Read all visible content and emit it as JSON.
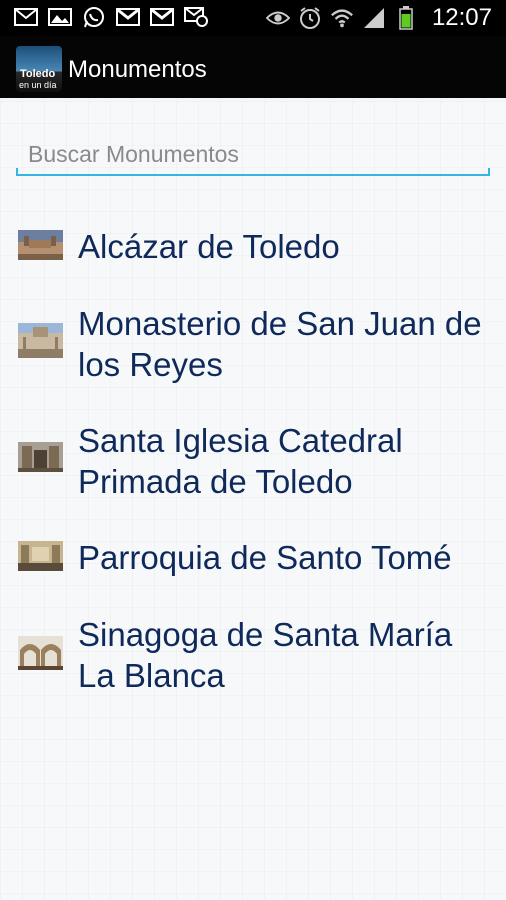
{
  "status_bar": {
    "time": "12:07",
    "left_icons": [
      "mail-icon",
      "image-icon",
      "whatsapp-icon",
      "gmail-icon",
      "gmail-icon",
      "email-sync-icon"
    ],
    "right_icons": [
      "eye-icon",
      "alarm-icon",
      "wifi-icon",
      "signal-icon",
      "battery-icon"
    ]
  },
  "action_bar": {
    "logo_text_line1": "Toledo",
    "logo_text_line2": "en un día",
    "title": "Monumentos"
  },
  "search": {
    "placeholder": "Buscar Monumentos",
    "value": ""
  },
  "monuments": [
    {
      "name": "Alcázar de Toledo",
      "thumb_colors": [
        "#6d7fa1",
        "#b59070",
        "#7a6048"
      ]
    },
    {
      "name": "Monasterio de San Juan de los Reyes",
      "thumb_colors": [
        "#9bb6d9",
        "#c9b9a0",
        "#8f7c66"
      ]
    },
    {
      "name": "Santa Iglesia Catedral Primada de Toledo",
      "thumb_colors": [
        "#a89f94",
        "#7d6a55",
        "#4e4032"
      ]
    },
    {
      "name": "Parroquia de Santo Tomé",
      "thumb_colors": [
        "#c7b58f",
        "#8d7a58",
        "#5a4c3a"
      ]
    },
    {
      "name": "Sinagoga de Santa María La Blanca",
      "thumb_colors": [
        "#e6e1d7",
        "#9c7f5d",
        "#5b4534"
      ]
    }
  ],
  "colors": {
    "accent": "#33b5e5",
    "item_text": "#0f2a5a",
    "action_bar": "#050505"
  }
}
